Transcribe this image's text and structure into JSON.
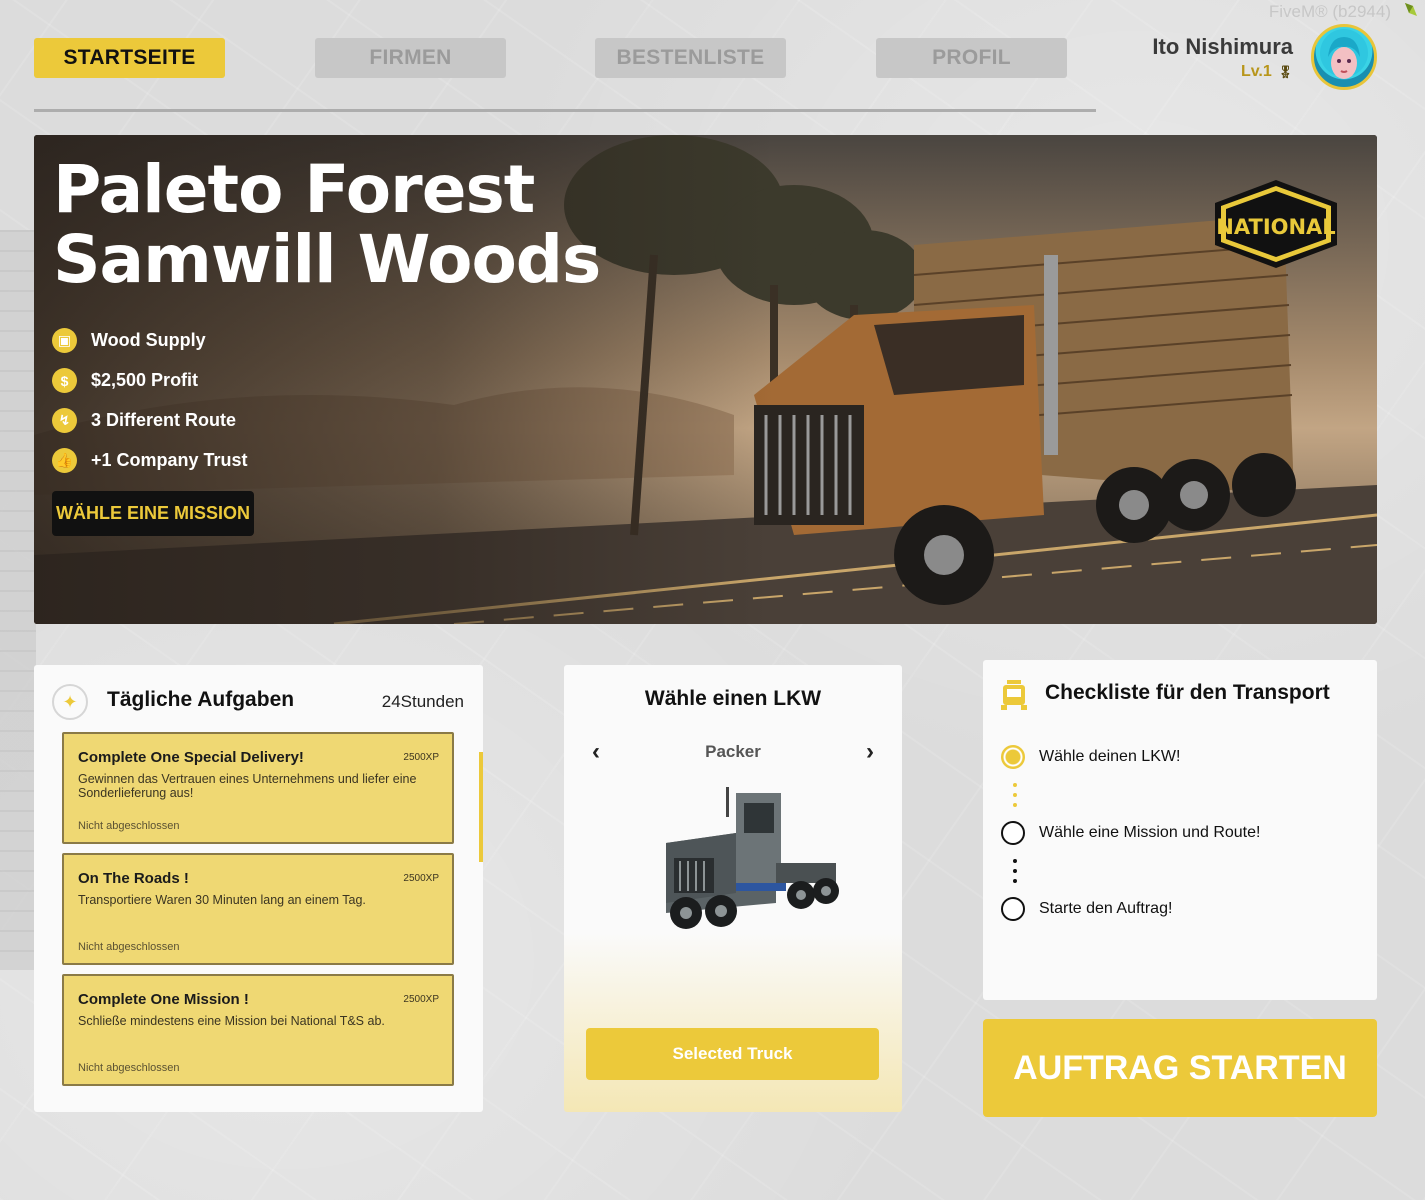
{
  "watermark": "FiveM® (b2944)",
  "nav": {
    "tabs": [
      {
        "label": "STARTSEITE",
        "active": true
      },
      {
        "label": "FIRMEN",
        "active": false
      },
      {
        "label": "BESTENLISTE",
        "active": false
      },
      {
        "label": "PROFIL",
        "active": false
      }
    ]
  },
  "profile": {
    "name": "Ito Nishimura",
    "level": "Lv.1"
  },
  "hero": {
    "title_line1": "Paleto Forest",
    "title_line2": "Samwill Woods",
    "features": [
      {
        "icon": "box-icon",
        "label": "Wood Supply"
      },
      {
        "icon": "dollar-icon",
        "label": "$2,500 Profit"
      },
      {
        "icon": "route-icon",
        "label": "3 Different Route"
      },
      {
        "icon": "thumbs-up-icon",
        "label": "+1 Company Trust"
      }
    ],
    "button_label": "WÄHLE EINE MISSION",
    "logo_text": "NATIONAL"
  },
  "tasks": {
    "title": "Tägliche Aufgaben",
    "timer": "24Stunden",
    "items": [
      {
        "title": "Complete One Special Delivery!",
        "xp": "2500XP",
        "desc": "Gewinnen das Vertrauen eines Unternehmens und liefer eine Sonderlieferung aus!",
        "status": "Nicht abgeschlossen"
      },
      {
        "title": "On The Roads !",
        "xp": "2500XP",
        "desc": "Transportiere Waren 30 Minuten lang an einem Tag.",
        "status": "Nicht abgeschlossen"
      },
      {
        "title": "Complete One Mission !",
        "xp": "2500XP",
        "desc": "Schließe mindestens eine Mission bei National T&S ab.",
        "status": "Nicht abgeschlossen"
      }
    ]
  },
  "truck": {
    "title": "Wähle einen LKW",
    "name": "Packer",
    "prev": "‹",
    "next": "›",
    "button_label": "Selected Truck"
  },
  "checklist": {
    "title": "Checkliste für den Transport",
    "items": [
      {
        "label": "Wähle deinen LKW!",
        "done": true
      },
      {
        "label": "Wähle eine Mission und Route!",
        "done": false
      },
      {
        "label": "Starte den Auftrag!",
        "done": false
      }
    ]
  },
  "start_button": "AUFTRAG STARTEN",
  "colors": {
    "accent": "#ecc93a",
    "inactive_tab": "#c7c7c7",
    "dark": "#111111"
  }
}
